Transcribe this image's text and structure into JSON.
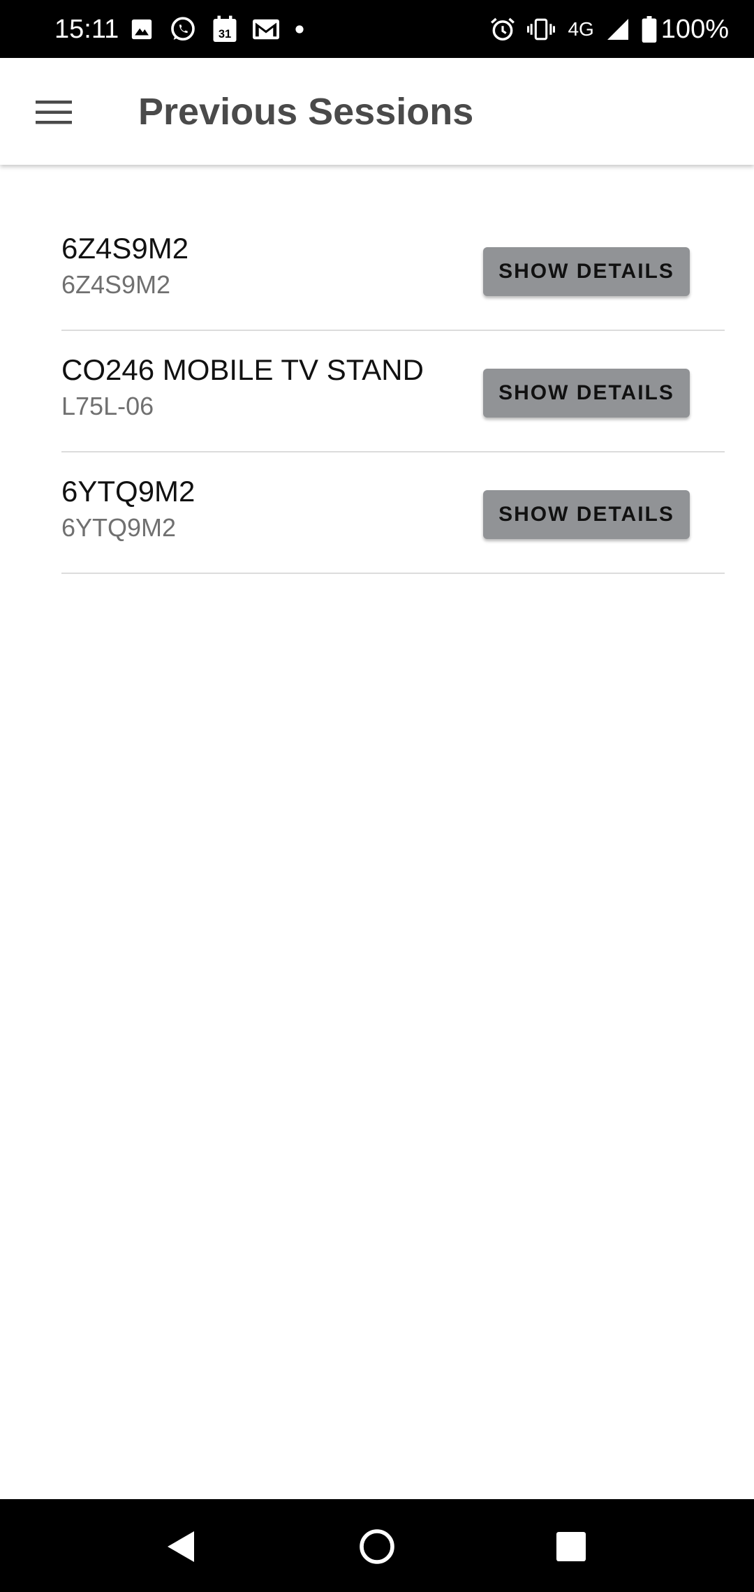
{
  "status_bar": {
    "time": "15:11",
    "network_label": "4G",
    "battery_text": "100%",
    "left_icons": [
      "image-icon",
      "whatsapp-icon",
      "calendar-icon",
      "gmail-icon",
      "notification-dot-icon"
    ],
    "calendar_day": "31",
    "right_icons": [
      "alarm-icon",
      "vibrate-icon",
      "signal-icon",
      "battery-icon"
    ]
  },
  "app_bar": {
    "menu_icon": "hamburger-menu-icon",
    "title": "Previous Sessions"
  },
  "sessions": [
    {
      "title": "6Z4S9M2",
      "subtitle": "6Z4S9M2",
      "button_label": "SHOW DETAILS"
    },
    {
      "title": "CO246 MOBILE TV STAND",
      "subtitle": "L75L-06",
      "button_label": "SHOW DETAILS"
    },
    {
      "title": "6YTQ9M2",
      "subtitle": "6YTQ9M2",
      "button_label": "SHOW DETAILS"
    }
  ],
  "nav_bar": {
    "icons": [
      "back-icon",
      "home-icon",
      "recents-icon"
    ]
  },
  "colors": {
    "status_bar_bg": "#000000",
    "app_title": "#4a4a4a",
    "button_bg": "#919396",
    "divider": "#dcdcdc",
    "subtitle": "#707070"
  }
}
